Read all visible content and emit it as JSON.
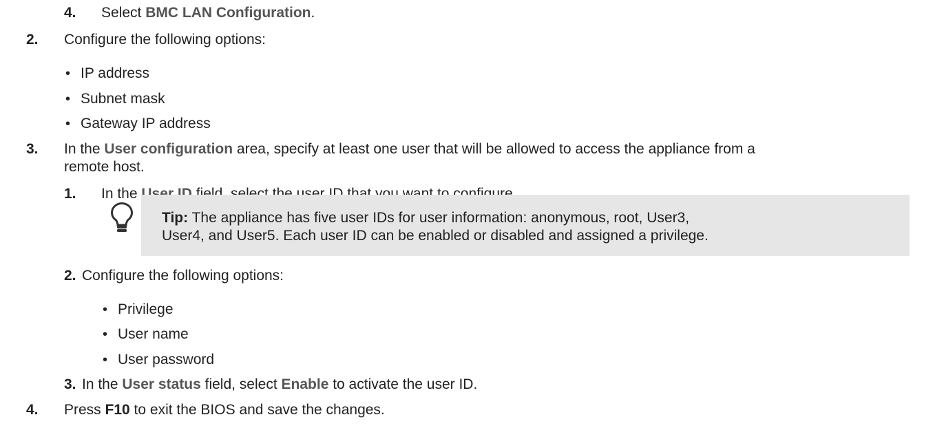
{
  "steps": {
    "s1_4": {
      "num": "4.",
      "pre": "Select ",
      "ui": "BMC LAN Configuration",
      "post": "."
    },
    "s2": {
      "num": "2.",
      "text": "Configure the following options:",
      "options": [
        "IP address",
        "Subnet mask",
        "Gateway IP address"
      ]
    },
    "s3": {
      "num": "3.",
      "pre": "In the ",
      "ui": "User configuration",
      "post": " area, specify at least one user that will be allowed to access the appliance from a",
      "cont": "remote host.",
      "sub1": {
        "num": "1.",
        "pre": "In the ",
        "ui": "User ID",
        "post": " field, select the user ID that you want to configure."
      },
      "tip": {
        "label": "Tip:",
        "line1": " The appliance has five user IDs for user information: anonymous, root, User3,",
        "line2": "User4, and User5. Each user ID can be enabled or disabled and assigned a privilege."
      },
      "sub2": {
        "num": "2.",
        "text": "Configure the following options:",
        "options": [
          "Privilege",
          "User name",
          "User password"
        ]
      },
      "sub3": {
        "num": "3.",
        "pre": "In the ",
        "ui": "User status",
        "mid": " field, select ",
        "ui2": "Enable",
        "post": " to activate the user ID."
      }
    },
    "s4": {
      "num": "4.",
      "pre": "Press ",
      "key": "F10",
      "post": " to exit the BIOS and save the changes."
    }
  },
  "bullet_glyph": "•",
  "tip_icon": "lightbulb-icon"
}
